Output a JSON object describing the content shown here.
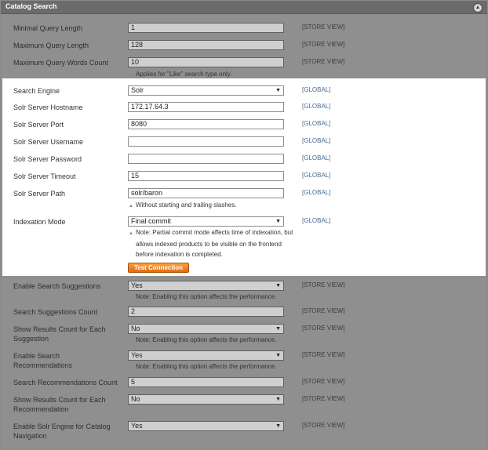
{
  "section": {
    "title": "Catalog Search"
  },
  "rows": {
    "min_query_length": {
      "label": "Minimal Query Length",
      "value": "1",
      "scope": "[STORE VIEW]"
    },
    "max_query_length": {
      "label": "Maximum Query Length",
      "value": "128",
      "scope": "[STORE VIEW]"
    },
    "max_query_words": {
      "label": "Maximum Query Words Count",
      "value": "10",
      "scope": "[STORE VIEW]",
      "note": "Applies for \"Like\" search type only."
    },
    "search_engine": {
      "label": "Search Engine",
      "value": "Solr",
      "scope": "[GLOBAL]"
    },
    "solr_hostname": {
      "label": "Solr Server Hostname",
      "value": "172.17.64.3",
      "scope": "[GLOBAL]"
    },
    "solr_port": {
      "label": "Solr Server Port",
      "value": "8080",
      "scope": "[GLOBAL]"
    },
    "solr_username": {
      "label": "Solr Server Username",
      "value": "",
      "scope": "[GLOBAL]"
    },
    "solr_password": {
      "label": "Solr Server Password",
      "value": "",
      "scope": "[GLOBAL]"
    },
    "solr_timeout": {
      "label": "Solr Server Timeout",
      "value": "15",
      "scope": "[GLOBAL]"
    },
    "solr_path": {
      "label": "Solr Server Path",
      "value": "solr/baron",
      "scope": "[GLOBAL]",
      "note": "Without starting and trailing slashes."
    },
    "indexation_mode": {
      "label": "Indexation Mode",
      "value": "Final commit",
      "scope": "[GLOBAL]",
      "note_lines": [
        "Note: Partial commit mode affects time of indexation, but",
        "allows indexed products to be visible on the frontend",
        "before indexation is completed."
      ]
    },
    "test_connection": {
      "label": "Test Connection"
    },
    "enable_suggestions": {
      "label": "Enable Search Suggestions",
      "value": "Yes",
      "scope": "[STORE VIEW]",
      "note": "Note: Enabling this option affects the performance."
    },
    "suggestions_count": {
      "label": "Search Suggestions Count",
      "value": "2",
      "scope": "[STORE VIEW]"
    },
    "show_results_count_suggestion": {
      "label_lines": [
        "Show Results Count for Each",
        "Suggestion"
      ],
      "value": "No",
      "scope": "[STORE VIEW]",
      "note": "Note: Enabling this option affects the performance."
    },
    "enable_recommendations": {
      "label_lines": [
        "Enable Search",
        "Recommendations"
      ],
      "value": "Yes",
      "scope": "[STORE VIEW]",
      "note": "Note: Enabling this option affects the performance."
    },
    "recommendations_count": {
      "label": "Search Recommendations Count",
      "value": "5",
      "scope": "[STORE VIEW]"
    },
    "show_results_count_recommendation": {
      "label_lines": [
        "Show Results Count for Each",
        "Recommendation"
      ],
      "value": "No",
      "scope": "[STORE VIEW]"
    },
    "enable_solr_navigation": {
      "label_lines": [
        "Enable Solr Engine for Catalog",
        "Navigation"
      ],
      "value": "Yes",
      "scope": "[STORE VIEW]"
    }
  }
}
